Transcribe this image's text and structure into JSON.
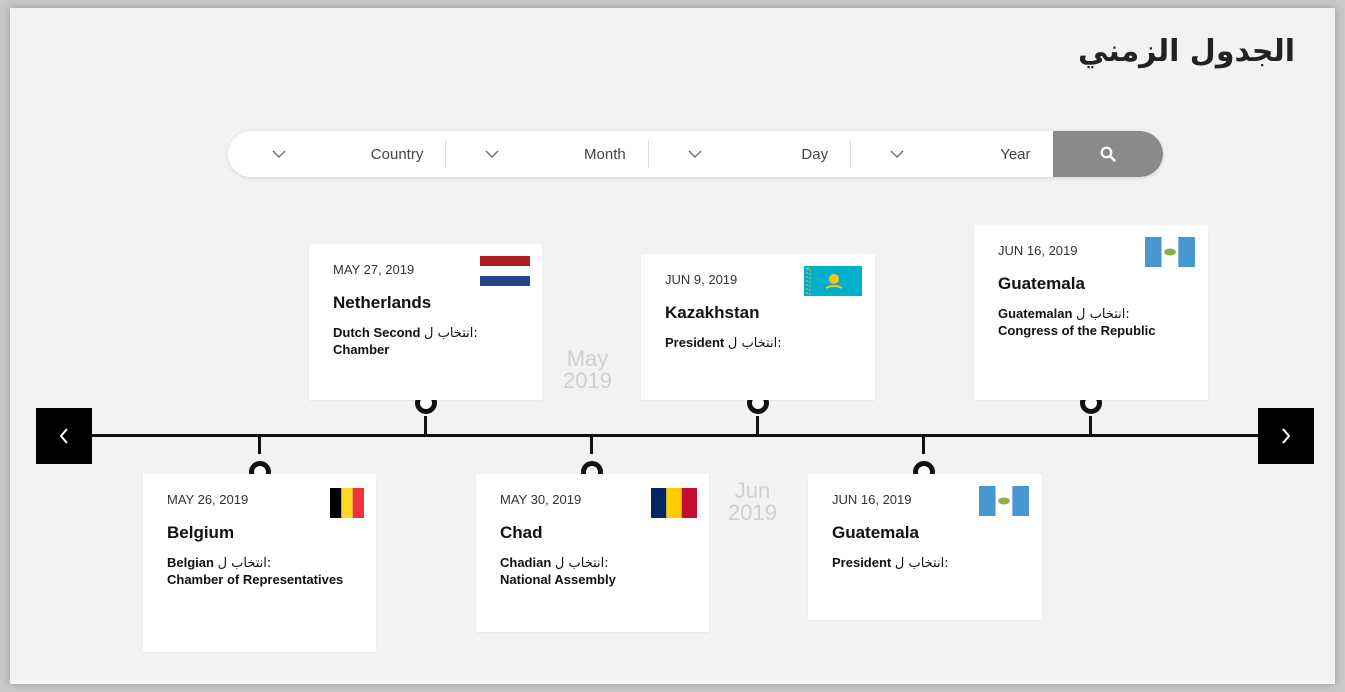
{
  "title": "الجدول الزمني",
  "filters": [
    {
      "label": "Country",
      "icon": "chevron-down-icon"
    },
    {
      "label": "Month",
      "icon": "chevron-down-icon"
    },
    {
      "label": "Day",
      "icon": "chevron-down-icon"
    },
    {
      "label": "Year",
      "icon": "chevron-down-icon"
    }
  ],
  "search_icon": "search-icon",
  "nav": {
    "prev_icon": "chevron-left-icon",
    "next_icon": "chevron-right-icon"
  },
  "months": [
    {
      "month": "May",
      "year": "2019"
    },
    {
      "month": "Jun",
      "year": "2019"
    }
  ],
  "election_prefix": "انتخاب ل:",
  "events": [
    {
      "date": "MAY 26, 2019",
      "country": "Belgium",
      "type": "Belgian Chamber of Representatives",
      "type_first": "Belgian",
      "type_rest": "Chamber of Representatives",
      "flag": "belgium-flag"
    },
    {
      "date": "MAY 27, 2019",
      "country": "Netherlands",
      "type": "Dutch Second Chamber",
      "type_first": "Dutch Second",
      "type_rest": "Chamber",
      "flag": "netherlands-flag"
    },
    {
      "date": "MAY 30, 2019",
      "country": "Chad",
      "type": "Chadian National Assembly",
      "type_first": "Chadian",
      "type_rest": "National Assembly",
      "flag": "chad-flag"
    },
    {
      "date": "JUN 9, 2019",
      "country": "Kazakhstan",
      "type": "President",
      "type_first": "President",
      "type_rest": "",
      "flag": "kazakhstan-flag"
    },
    {
      "date": "JUN 16, 2019",
      "country": "Guatemala",
      "type": "President",
      "type_first": "President",
      "type_rest": "",
      "flag": "guatemala-flag"
    },
    {
      "date": "JUN 16, 2019",
      "country": "Guatemala",
      "type": "Guatemalan Congress of the Republic",
      "type_first": "Guatemalan",
      "type_rest": "Congress of the Republic",
      "flag": "guatemala-flag"
    }
  ],
  "colors": {
    "axis": "#111111",
    "search_button": "#8a8a8a",
    "background": "#f2f2f2",
    "month_label": "#d0d0d0"
  }
}
